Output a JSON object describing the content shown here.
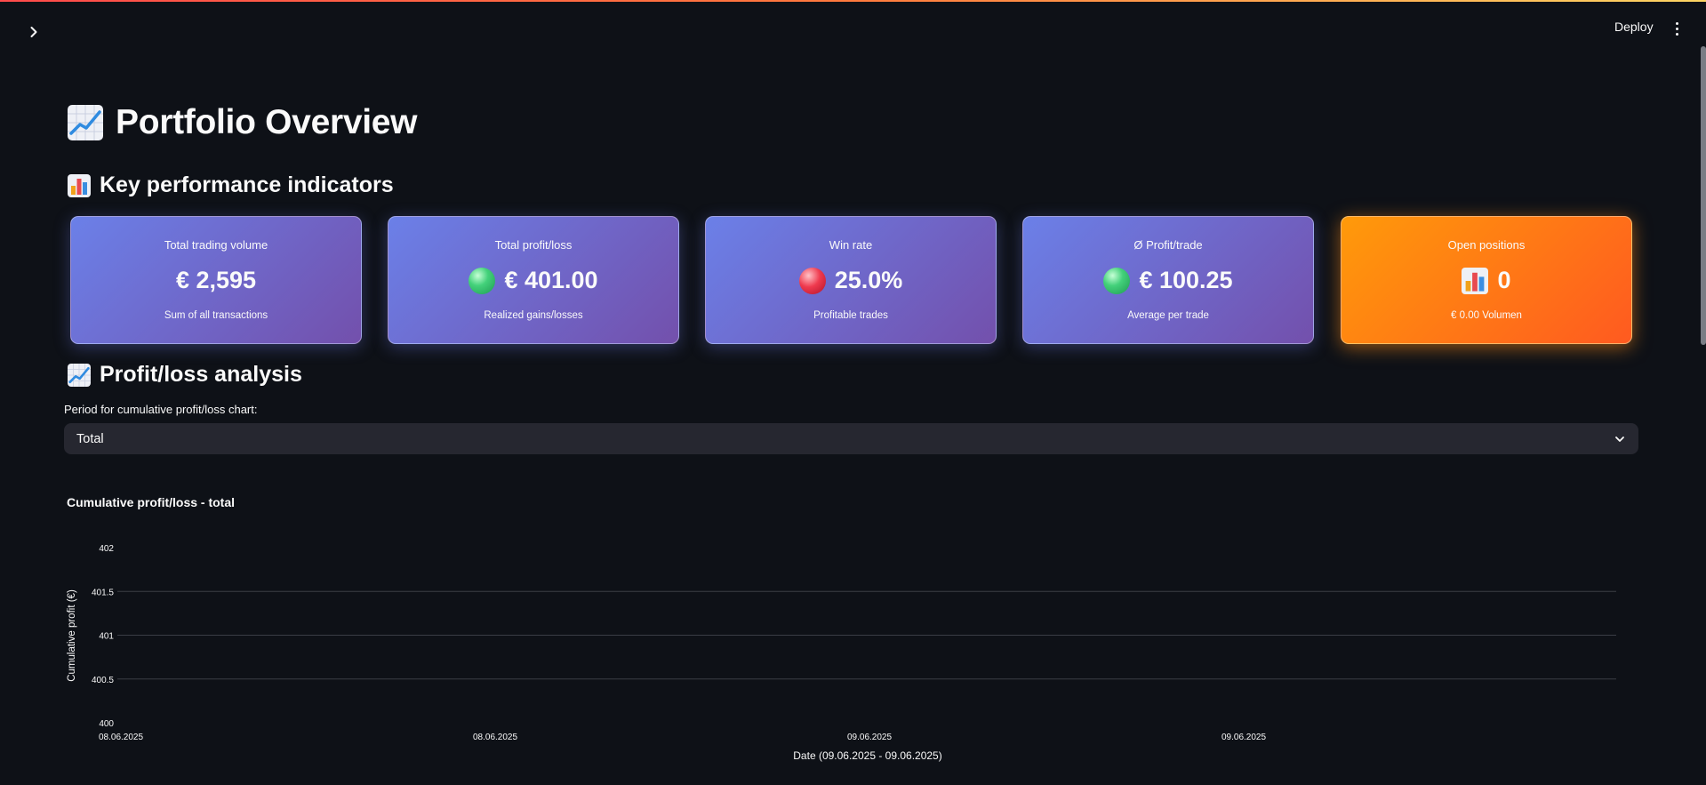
{
  "header": {
    "deploy_label": "Deploy",
    "icons": [
      "chevron-right-icon",
      "more-vertical-icon"
    ]
  },
  "page": {
    "title": "Portfolio Overview",
    "title_icon": "chart-increasing-emoji",
    "kpi_heading": "Key performance indicators",
    "kpi_heading_icon": "bar-chart-emoji",
    "analysis_heading": "Profit/loss analysis",
    "analysis_heading_icon": "chart-increasing-emoji"
  },
  "kpis": [
    {
      "label": "Total trading volume",
      "value": "€ 2,595",
      "sub": "Sum of all transactions",
      "icon": null,
      "accent": "#6b80e8"
    },
    {
      "label": "Total profit/loss",
      "value": "€ 401.00",
      "sub": "Realized gains/losses",
      "icon": "green-circle",
      "accent": "#6b80e8"
    },
    {
      "label": "Win rate",
      "value": "25.0%",
      "sub": "Profitable trades",
      "icon": "red-circle",
      "accent": "#6b80e8"
    },
    {
      "label": "Ø Profit/trade",
      "value": "€ 100.25",
      "sub": "Average per trade",
      "icon": "green-circle",
      "accent": "#6b80e8"
    },
    {
      "label": "Open positions",
      "value": "0",
      "sub": "€ 0.00 Volumen",
      "icon": "bar-chart-emoji",
      "accent": "#ff8c10"
    }
  ],
  "period_select": {
    "label": "Period for cumulative profit/loss chart:",
    "value": "Total"
  },
  "colors": {
    "background": "#0e1117",
    "card_gradient_start": "#6b80e8",
    "card_gradient_end": "#7350ac",
    "orange_start": "#ff9a0a",
    "orange_end": "#ff5a20",
    "select_bg": "#262730"
  },
  "chart_data": {
    "type": "line",
    "title": "Cumulative profit/loss - total",
    "xlabel": "Date (09.06.2025 - 09.06.2025)",
    "ylabel": "Cumulative profit (€)",
    "ylim": [
      400,
      402
    ],
    "y_ticks": [
      "402",
      "401.5",
      "401",
      "400.5",
      "400"
    ],
    "x_tick_labels": [
      "08.06.2025",
      "08.06.2025",
      "09.06.2025",
      "09.06.2025"
    ],
    "grid": true,
    "series": []
  }
}
